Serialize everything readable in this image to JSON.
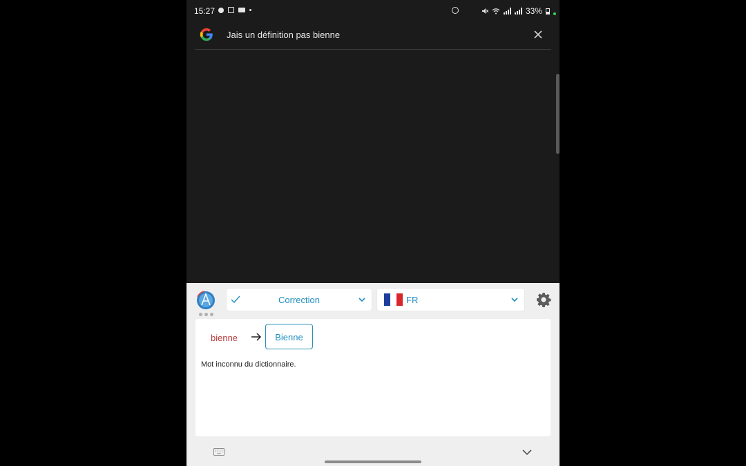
{
  "status_bar": {
    "time": "15:27",
    "battery": "33%"
  },
  "search": {
    "query": "Jais un définition pas bienne"
  },
  "keyboard_panel": {
    "mode_label": "Correction",
    "language_label": "FR",
    "correction": {
      "original_word": "bienne",
      "suggestion": "Bienne",
      "message": "Mot inconnu du dictionnaire."
    }
  },
  "colors": {
    "accent": "#1f8fbf",
    "error": "#b73a3a",
    "panel_bg": "#efefef",
    "screen_bg": "#1b1b1b"
  }
}
